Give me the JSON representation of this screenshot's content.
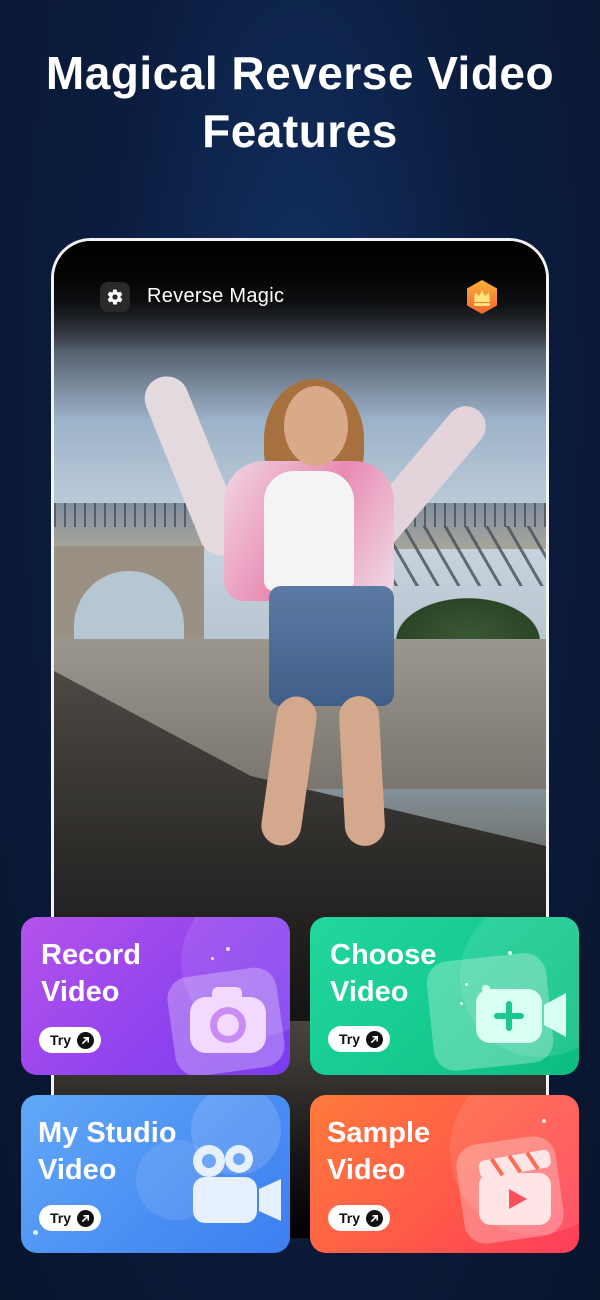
{
  "headline": {
    "line1": "Magical Reverse Video",
    "line2": "Features"
  },
  "app": {
    "title": "Reverse Magic",
    "settings_icon": "gear-icon",
    "premium_icon": "crown-icon"
  },
  "cards": [
    {
      "id": "record",
      "title_line1": "Record",
      "title_line2": "Video",
      "try_label": "Try",
      "icon": "camera-icon",
      "color_from": "#b04fe7",
      "color_to": "#7c3df0"
    },
    {
      "id": "choose",
      "title_line1": "Choose",
      "title_line2": "Video",
      "try_label": "Try",
      "icon": "video-add-icon",
      "color_from": "#1fd39a",
      "color_to": "#0fbf85"
    },
    {
      "id": "studio",
      "title_line1": "My Studio",
      "title_line2": "Video",
      "try_label": "Try",
      "icon": "film-camera-icon",
      "color_from": "#5aa2f5",
      "color_to": "#3c7ff0"
    },
    {
      "id": "sample",
      "title_line1": "Sample",
      "title_line2": "Video",
      "try_label": "Try",
      "icon": "clapper-play-icon",
      "color_from": "#ff6b3d",
      "color_to": "#ff3f5a"
    }
  ]
}
